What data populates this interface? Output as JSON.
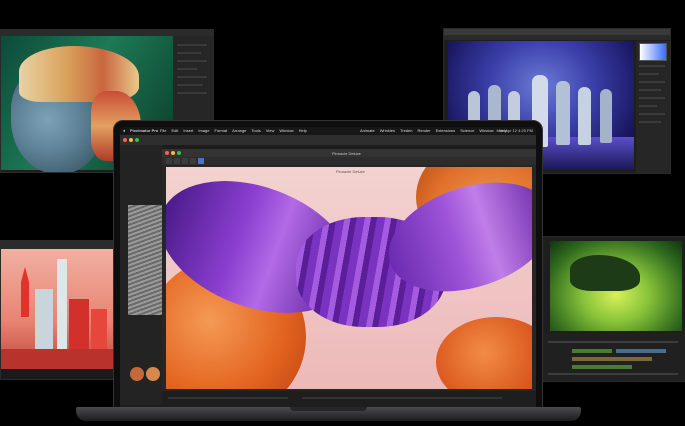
{
  "laptop": {
    "menubar": {
      "app_name": "Pixelmator Pro",
      "items": [
        "File",
        "Edit",
        "Insert",
        "Image",
        "Format",
        "Arrange",
        "Tools",
        "View",
        "Window",
        "Help"
      ],
      "right_items": [
        "Animate",
        "Wrinkles",
        "Treden",
        "Render",
        "Extensions",
        "Science",
        "Window",
        "Help"
      ],
      "clock": "Mon Apr 12 4:25 PM"
    },
    "document": {
      "tab_title": "Pinnacle Deluxe",
      "canvas_title": "Pinnacle Deluxe"
    },
    "colors": {
      "canvas_bg": "#f1c7c7",
      "ribbon_purple": "#6f2ca8",
      "ribbon_violet": "#9d54d8",
      "blob_orange": "#e36a22"
    }
  },
  "windows": {
    "portrait_app": {
      "icon": "photo-portrait"
    },
    "dancers_app": {
      "icon": "photo-dancers"
    },
    "city_app": {
      "icon": "3d-render-city"
    },
    "video_app": {
      "icon": "video-editor-green"
    }
  }
}
